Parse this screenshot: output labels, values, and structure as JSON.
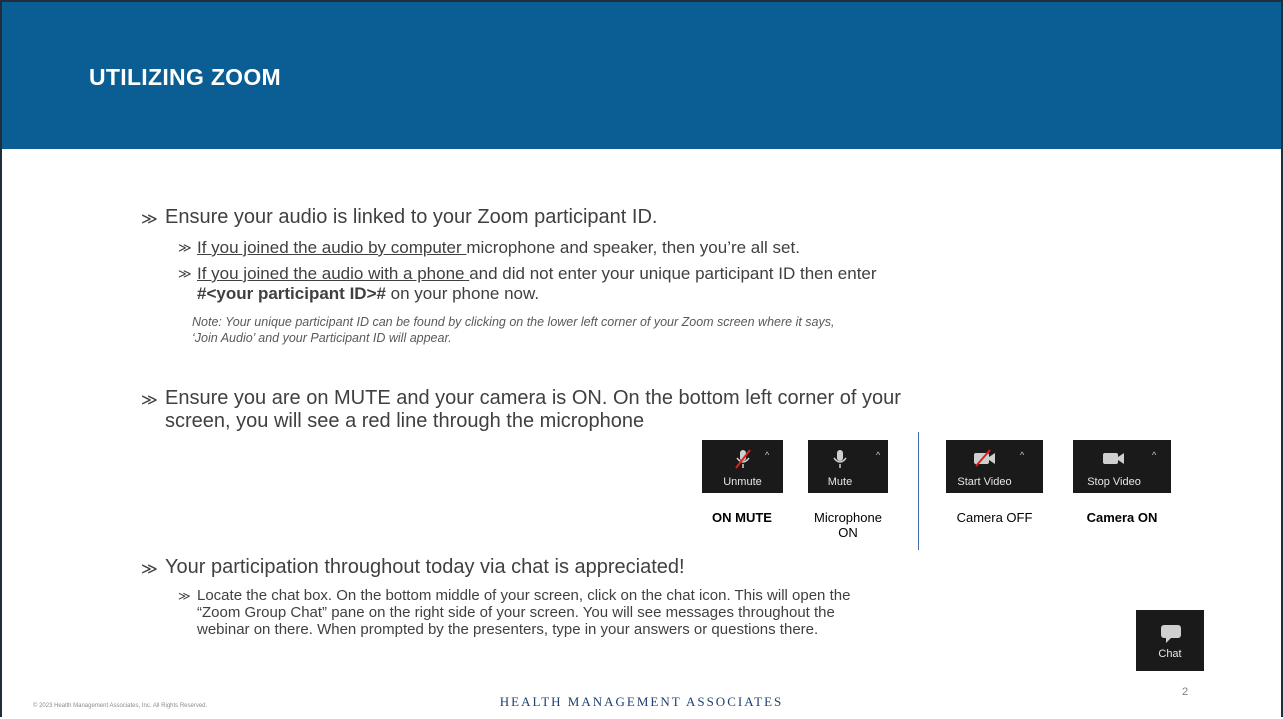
{
  "slide": {
    "title": "UTILIZING ZOOM",
    "bullets": {
      "b1": "Ensure your audio is linked to your Zoom participant ID.",
      "b1a_underline": "If you joined the audio by computer ",
      "b1a_rest": "microphone and speaker, then you’re all set.",
      "b1b_underline": "If you joined the audio with a phone ",
      "b1b_rest": "and did not enter your unique participant ID then enter",
      "b1b_bold": "#<your participant ID>#",
      "b1b_end": " on your phone now.",
      "note_line1": "Note: Your unique participant ID can be found by clicking on the lower left corner of your Zoom screen where it says,",
      "note_line2": "‘Join Audio’ and your Participant ID will appear.",
      "b2_line1": "Ensure you are on MUTE and your camera is ON. On the bottom left corner of your",
      "b2_line2": "screen, you will see a red line through the microphone",
      "b3": "Your participation throughout today via chat is appreciated!",
      "b3a_line1": "Locate the chat box. On the bottom middle of your screen, click on the chat icon. This will open the",
      "b3a_line2": "“Zoom Group Chat” pane on the right side of your screen. You will see messages throughout the",
      "b3a_line3": "webinar on there. When prompted by the presenters, type in your answers or questions there."
    },
    "zoom_buttons": [
      {
        "label": "Unmute",
        "caption": "ON MUTE",
        "icon": "mic-muted-icon"
      },
      {
        "label": "Mute",
        "caption": "Microphone ON",
        "icon": "mic-icon"
      },
      {
        "label": "Start Video",
        "caption": "Camera OFF",
        "icon": "video-off-icon"
      },
      {
        "label": "Stop Video",
        "caption": "Camera ON",
        "icon": "video-icon"
      }
    ],
    "mic_caption_line1": "Microphone",
    "mic_caption_line2": "ON",
    "chat_button": {
      "label": "Chat",
      "icon": "chat-icon"
    },
    "footer": {
      "copyright": "© 2023 Health Management Associates, Inc. All Rights Reserved.",
      "brand": "HEALTH MANAGEMENT ASSOCIATES",
      "page_number": "2"
    },
    "colors": {
      "header": "#0b5e93",
      "button_bg": "#1a1a1a",
      "muted_slash": "#e02020",
      "divider": "#3f6fb3"
    }
  }
}
